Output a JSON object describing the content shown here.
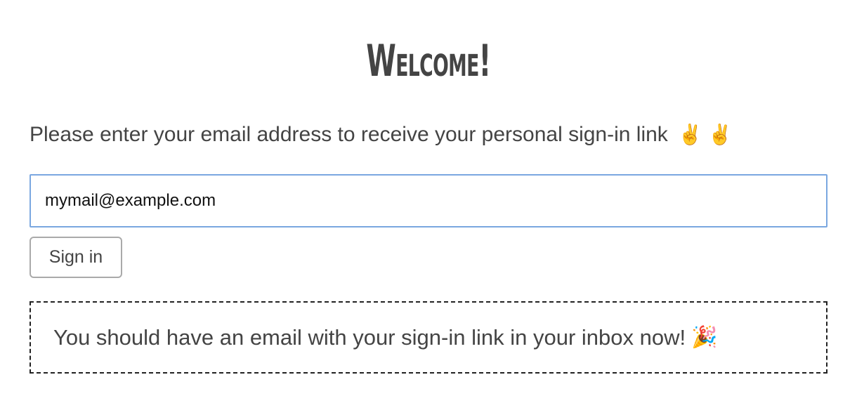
{
  "page": {
    "title": "Welcome!"
  },
  "intro": {
    "text": "Please enter your email address to receive your personal sign-in link",
    "emoji": "✌️ ✌️"
  },
  "email_field": {
    "value": "mymail@example.com",
    "placeholder": ""
  },
  "sign_in_button": {
    "label": "Sign in"
  },
  "success_message": {
    "text": "You should have an email with your sign-in link in your inbox now!",
    "emoji": "🎉"
  },
  "colors": {
    "text": "#444444",
    "input_border_focus": "#7aa7e0",
    "button_border": "#aaaaaa",
    "message_border": "#222222"
  }
}
